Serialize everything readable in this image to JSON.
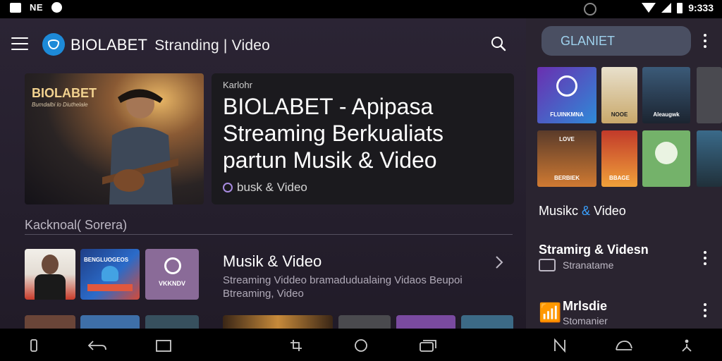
{
  "status_bar": {
    "left_label": "NE",
    "clock": "9:333"
  },
  "app_bar": {
    "brand": "BIOLABET",
    "subtitle": "Stranding | Video"
  },
  "hero": {
    "thumb_brand": "BIOLABET",
    "thumb_subtitle": "Bumdalbi lo Diuthelale",
    "kicker": "Karlohr",
    "headline": "BIOLABET -   Apipasa Streaming Berkualiats partun Musik & Video",
    "tag": "busk & Video"
  },
  "section": {
    "label": "Kacknoal( Sorera)"
  },
  "list_item": {
    "title": "Musik & Video",
    "description": "Streaming Viddeo bramadudualaing Vidaos Beupoi Btreaming, Video",
    "thumb2_label": "BENGLUOGEOS",
    "thumb3_label": "VKKNDV"
  },
  "side_panel": {
    "search_text": "GLANIET",
    "tile_captions": [
      "FLUINKMNA",
      "NOOE",
      "Aleaugwk",
      "LOVE",
      "BERBIEK",
      "BBAGE",
      "",
      ""
    ],
    "label_left": "Musikc ",
    "label_amp": "&",
    "label_right": " Video",
    "item1_title": "Stramirg & Videsn",
    "item1_sub": "Stranatame",
    "item2_title": "Mrlsdie",
    "item2_sub": "Stomanier"
  },
  "colors": {
    "background": "#2b2434",
    "accent": "#3aa0ff",
    "logo": "#1d8ad8"
  }
}
